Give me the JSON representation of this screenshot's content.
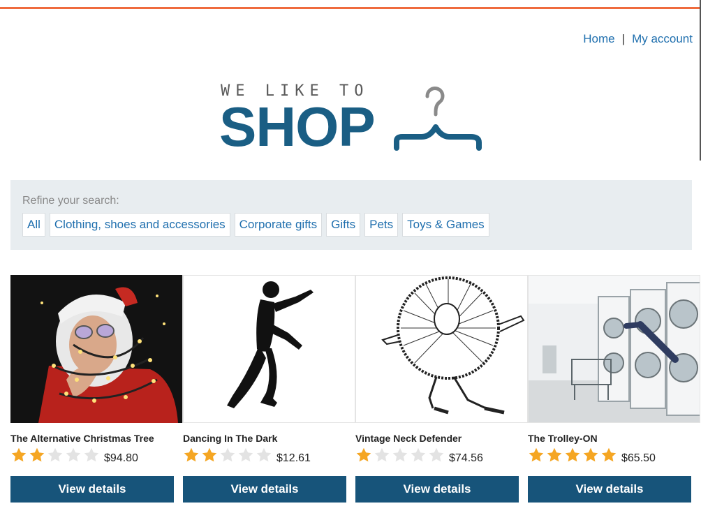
{
  "nav": {
    "home": "Home",
    "separator": "|",
    "account": "My account"
  },
  "logo": {
    "tagline": "WE LIKE TO",
    "wordmark": "SHOP",
    "icon": "hanger-icon"
  },
  "filters": {
    "label": "Refine your search:",
    "items": [
      "All",
      "Clothing, shoes and accessories",
      "Corporate gifts",
      "Gifts",
      "Pets",
      "Toys & Games"
    ]
  },
  "products": [
    {
      "name": "The Alternative Christmas Tree",
      "rating": 2,
      "max_rating": 5,
      "price": "$94.80",
      "button": "View details"
    },
    {
      "name": "Dancing In The Dark",
      "rating": 2,
      "max_rating": 5,
      "price": "$12.61",
      "button": "View details"
    },
    {
      "name": "Vintage Neck Defender",
      "rating": 1,
      "max_rating": 5,
      "price": "$74.56",
      "button": "View details"
    },
    {
      "name": "The Trolley-ON",
      "rating": 5,
      "max_rating": 5,
      "price": "$65.50",
      "button": "View details"
    }
  ],
  "colors": {
    "accent_bar": "#ef6b3d",
    "brand": "#1a5e84",
    "link": "#1f6fae",
    "button": "#17547a",
    "star_on": "#f5a623",
    "star_off": "#e3e3e3"
  }
}
